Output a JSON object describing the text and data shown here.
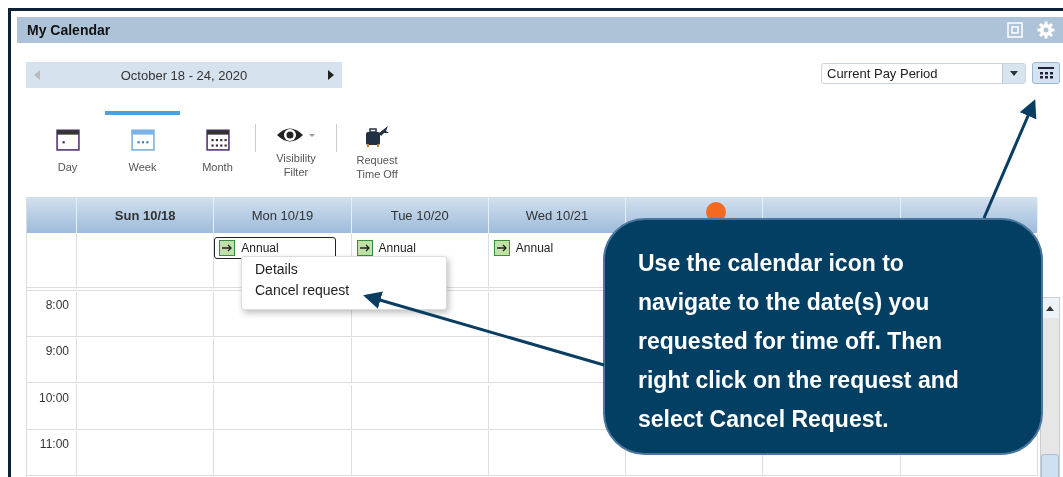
{
  "window": {
    "title": "My Calendar"
  },
  "date_nav": {
    "range": "October 18 - 24, 2020"
  },
  "period_select": {
    "value": "Current Pay Period"
  },
  "view_tabs": [
    {
      "label": "Day",
      "selected": false
    },
    {
      "label": "Week",
      "selected": true
    },
    {
      "label": "Month",
      "selected": false
    }
  ],
  "tools": [
    {
      "kind": "eye",
      "label": "Visibility Filter"
    },
    {
      "kind": "luggage",
      "label": "Request Time Off"
    }
  ],
  "calendar": {
    "columns": [
      {
        "label": "Sun 10/18",
        "today": true
      },
      {
        "label": "Mon 10/19",
        "today": false,
        "events": [
          {
            "label": "Annual",
            "selected": true
          }
        ]
      },
      {
        "label": "Tue 10/20",
        "today": false,
        "events": [
          {
            "label": "Annual",
            "selected": false
          }
        ]
      },
      {
        "label": "Wed 10/21",
        "today": false,
        "events": [
          {
            "label": "Annual",
            "selected": false
          }
        ]
      },
      {
        "badge": true
      },
      {},
      {}
    ],
    "hours": [
      "8:00",
      "9:00",
      "10:00",
      "11:00"
    ]
  },
  "context_menu": {
    "items": [
      {
        "label": "Details"
      },
      {
        "label": "Cancel request"
      }
    ]
  },
  "callout": {
    "text": "Use the calendar icon to navigate to the date(s) you requested for time off. Then right click on the request and select Cancel Request."
  }
}
